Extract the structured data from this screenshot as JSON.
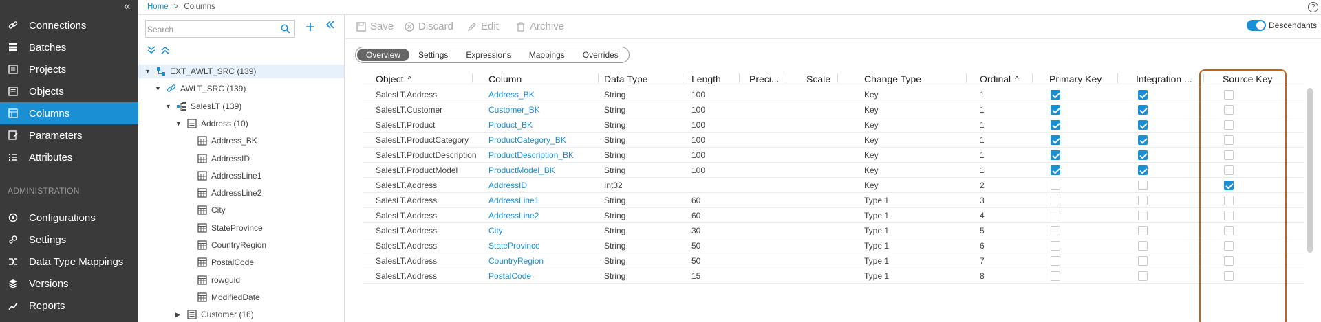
{
  "sidebar": {
    "items": [
      {
        "label": "Connections",
        "icon": "link-icon"
      },
      {
        "label": "Batches",
        "icon": "batches-icon"
      },
      {
        "label": "Projects",
        "icon": "projects-icon"
      },
      {
        "label": "Objects",
        "icon": "objects-icon"
      },
      {
        "label": "Columns",
        "icon": "columns-icon",
        "active": true
      },
      {
        "label": "Parameters",
        "icon": "parameters-icon"
      },
      {
        "label": "Attributes",
        "icon": "attributes-icon"
      }
    ],
    "admin_heading": "ADMINISTRATION",
    "admin_items": [
      {
        "label": "Configurations",
        "icon": "configurations-icon"
      },
      {
        "label": "Settings",
        "icon": "settings-icon"
      },
      {
        "label": "Data Type Mappings",
        "icon": "mappings-icon"
      },
      {
        "label": "Versions",
        "icon": "versions-icon"
      },
      {
        "label": "Reports",
        "icon": "reports-icon"
      }
    ],
    "collapse": "«"
  },
  "breadcrumb": {
    "home": "Home",
    "sep": ">",
    "current": "Columns"
  },
  "help": "?",
  "tree": {
    "search_placeholder": "Search",
    "add": "+",
    "collapse": "«",
    "nodes": [
      {
        "label": "EXT_AWLT_SRC (139)"
      },
      {
        "label": "AWLT_SRC (139)"
      },
      {
        "label": "SalesLT (139)"
      },
      {
        "label": "Address (10)"
      },
      {
        "label": "Address_BK"
      },
      {
        "label": "AddressID"
      },
      {
        "label": "AddressLine1"
      },
      {
        "label": "AddressLine2"
      },
      {
        "label": "City"
      },
      {
        "label": "StateProvince"
      },
      {
        "label": "CountryRegion"
      },
      {
        "label": "PostalCode"
      },
      {
        "label": "rowguid"
      },
      {
        "label": "ModifiedDate"
      },
      {
        "label": "Customer (16)"
      }
    ]
  },
  "toolbar": {
    "save": "Save",
    "discard": "Discard",
    "edit": "Edit",
    "archive": "Archive",
    "descendants": "Descendants",
    "descendants_on": true
  },
  "tabs": [
    "Overview",
    "Settings",
    "Expressions",
    "Mappings",
    "Overrides"
  ],
  "table": {
    "headers": [
      "Object",
      "Column",
      "Data Type",
      "Length",
      "Preci...",
      "Scale",
      "Change Type",
      "Ordinal",
      "Primary Key",
      "Integration ...",
      "Source Key"
    ],
    "rows": [
      {
        "object": "SalesLT.Address",
        "column": "Address_BK",
        "type": "String",
        "length": "100",
        "change": "Key",
        "ordinal": "1",
        "pk": true,
        "ik": true,
        "sk": false
      },
      {
        "object": "SalesLT.Customer",
        "column": "Customer_BK",
        "type": "String",
        "length": "100",
        "change": "Key",
        "ordinal": "1",
        "pk": true,
        "ik": true,
        "sk": false
      },
      {
        "object": "SalesLT.Product",
        "column": "Product_BK",
        "type": "String",
        "length": "100",
        "change": "Key",
        "ordinal": "1",
        "pk": true,
        "ik": true,
        "sk": false
      },
      {
        "object": "SalesLT.ProductCategory",
        "column": "ProductCategory_BK",
        "type": "String",
        "length": "100",
        "change": "Key",
        "ordinal": "1",
        "pk": true,
        "ik": true,
        "sk": false
      },
      {
        "object": "SalesLT.ProductDescription",
        "column": "ProductDescription_BK",
        "type": "String",
        "length": "100",
        "change": "Key",
        "ordinal": "1",
        "pk": true,
        "ik": true,
        "sk": false
      },
      {
        "object": "SalesLT.ProductModel",
        "column": "ProductModel_BK",
        "type": "String",
        "length": "100",
        "change": "Key",
        "ordinal": "1",
        "pk": true,
        "ik": true,
        "sk": false
      },
      {
        "object": "SalesLT.Address",
        "column": "AddressID",
        "type": "Int32",
        "length": "",
        "change": "Key",
        "ordinal": "2",
        "pk": false,
        "ik": false,
        "sk": true
      },
      {
        "object": "SalesLT.Address",
        "column": "AddressLine1",
        "type": "String",
        "length": "60",
        "change": "Type 1",
        "ordinal": "3",
        "pk": false,
        "ik": false,
        "sk": false
      },
      {
        "object": "SalesLT.Address",
        "column": "AddressLine2",
        "type": "String",
        "length": "60",
        "change": "Type 1",
        "ordinal": "4",
        "pk": false,
        "ik": false,
        "sk": false
      },
      {
        "object": "SalesLT.Address",
        "column": "City",
        "type": "String",
        "length": "30",
        "change": "Type 1",
        "ordinal": "5",
        "pk": false,
        "ik": false,
        "sk": false
      },
      {
        "object": "SalesLT.Address",
        "column": "StateProvince",
        "type": "String",
        "length": "50",
        "change": "Type 1",
        "ordinal": "6",
        "pk": false,
        "ik": false,
        "sk": false
      },
      {
        "object": "SalesLT.Address",
        "column": "CountryRegion",
        "type": "String",
        "length": "50",
        "change": "Type 1",
        "ordinal": "7",
        "pk": false,
        "ik": false,
        "sk": false
      },
      {
        "object": "SalesLT.Address",
        "column": "PostalCode",
        "type": "String",
        "length": "15",
        "change": "Type 1",
        "ordinal": "8",
        "pk": false,
        "ik": false,
        "sk": false
      }
    ]
  }
}
